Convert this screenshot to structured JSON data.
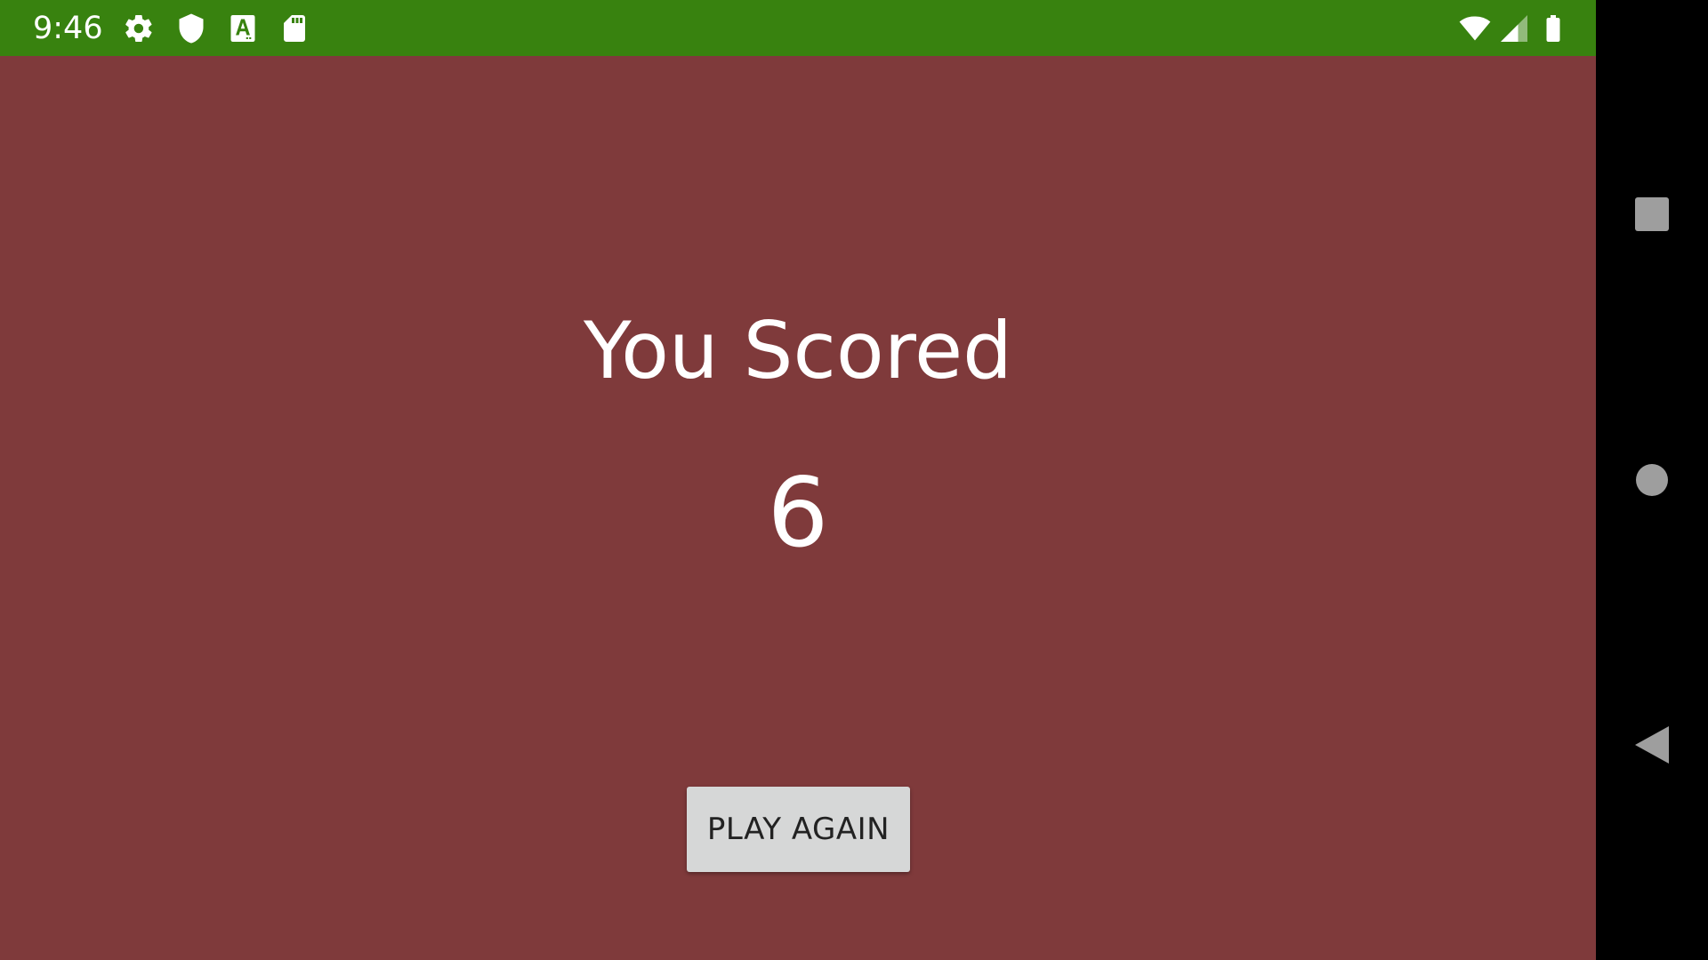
{
  "status_bar": {
    "time": "9:46",
    "left_icons": [
      "settings-icon",
      "shield-icon",
      "font-a-icon",
      "sd-card-icon"
    ],
    "right_icons": [
      "wifi-icon",
      "cell-signal-icon",
      "battery-icon"
    ],
    "color": "#38820f"
  },
  "main": {
    "title": "You Scored",
    "score": "6",
    "play_again_label": "PLAY AGAIN",
    "background": "#7f3a3b"
  },
  "nav_bar": {
    "buttons": [
      "recents-square-icon",
      "home-circle-icon",
      "back-triangle-icon"
    ]
  }
}
